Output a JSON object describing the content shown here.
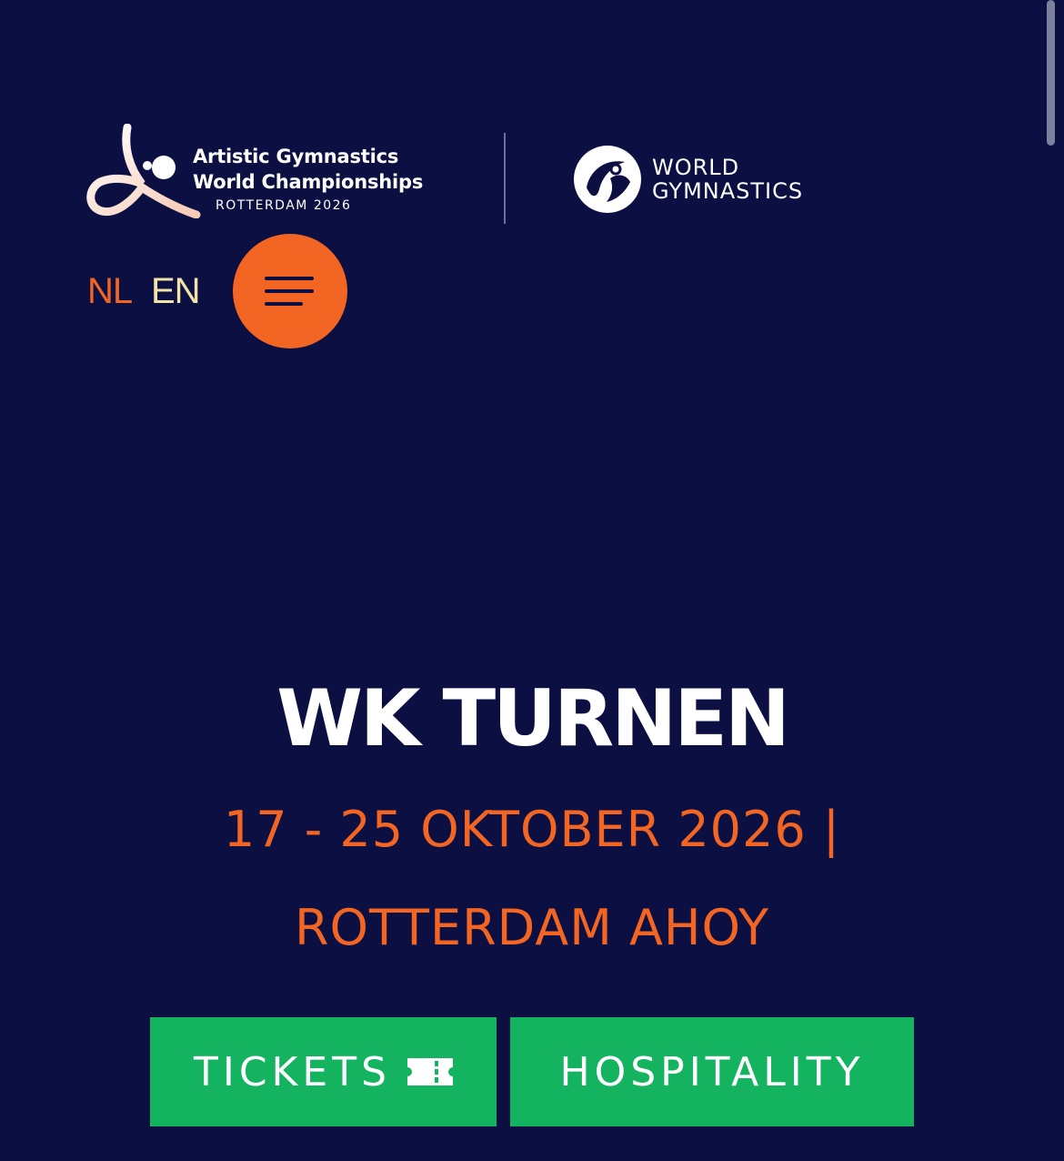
{
  "header": {
    "event_logo": {
      "line1": "Artistic Gymnastics",
      "line2": "World Championships",
      "subline": "ROTTERDAM 2026"
    },
    "partner_logo": {
      "line1": "WORLD",
      "line2": "GYMNASTICS"
    }
  },
  "language_switch": {
    "nl": "NL",
    "en": "EN"
  },
  "hero": {
    "title": "WK TURNEN",
    "dates": "17 - 25 OKTOBER 2026 |",
    "venue": "ROTTERDAM AHOY"
  },
  "cta": {
    "tickets_label": "TICKETS",
    "hospitality_label": "HOSPITALITY"
  },
  "colors": {
    "background": "#0b0f42",
    "accent_orange": "#f26522",
    "language_active": "#f4e3a6",
    "cta_green": "#14b35f",
    "text_white": "#ffffff"
  },
  "icons": {
    "menu": "hamburger-menu-icon",
    "tickets": "ticket-icon"
  }
}
